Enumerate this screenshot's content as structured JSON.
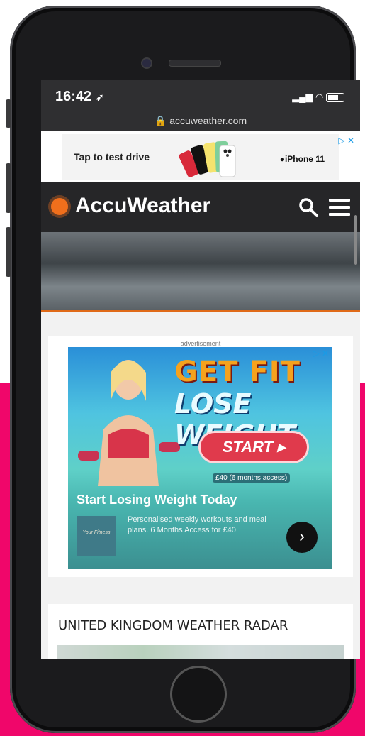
{
  "status": {
    "time": "16:42",
    "signal": ".ıl",
    "wifi": "wifi",
    "battery": "battery"
  },
  "browser": {
    "url": "accuweather.com",
    "lock_icon": "lock-icon"
  },
  "top_ad": {
    "left_text": "Tap to test drive",
    "right_text": "iPhone 11",
    "brand_icon": "apple-icon",
    "close": "▷ ✕"
  },
  "nav": {
    "logo_text": "AccuWeather",
    "search_icon": "search-icon",
    "menu_icon": "hamburger-menu-icon"
  },
  "ad": {
    "label": "advertisement",
    "headline1": "GET FIT",
    "headline2": "LOSE WEIGHT",
    "start_label": "START ▸",
    "access_text": "£40 (6 months access)",
    "title": "Start Losing Weight Today",
    "description": "Personalised weekly workouts and meal plans. 6 Months Access for £40",
    "brand_box": "Your Fitness",
    "arrow": "›",
    "close": "▷ ✕"
  },
  "radar": {
    "title": "UNITED KINGDOM WEATHER RADAR"
  },
  "colors": {
    "accent": "#f06f1c",
    "background_pink": "#f0066a",
    "nav_bg": "#262628"
  }
}
